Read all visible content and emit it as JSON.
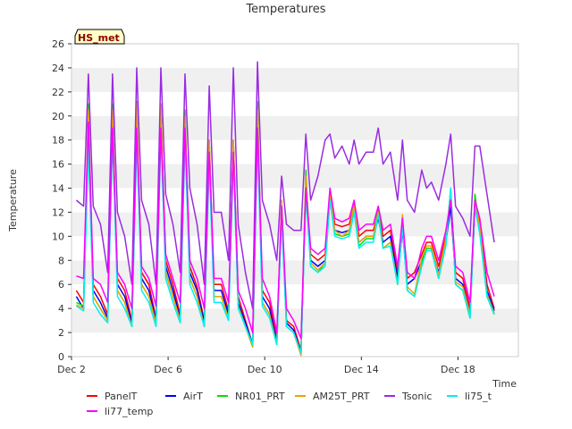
{
  "chart_data": {
    "type": "line",
    "title": "Temperatures",
    "xlabel": "Time",
    "ylabel": "Temperature",
    "badge": "HS_met",
    "ylim": [
      0,
      26
    ],
    "xlim": [
      0,
      18.5
    ],
    "x_unit": "days since Dec 2",
    "yticks": [
      0,
      2,
      4,
      6,
      8,
      10,
      12,
      14,
      16,
      18,
      20,
      22,
      24,
      26
    ],
    "xticks": [
      {
        "value": 0,
        "label": "Dec 2"
      },
      {
        "value": 4,
        "label": "Dec 6"
      },
      {
        "value": 8,
        "label": "Dec 10"
      },
      {
        "value": 12,
        "label": "Dec 14"
      },
      {
        "value": 16,
        "label": "Dec 18"
      }
    ],
    "grid": "horizontal-bands",
    "legend_position": "bottom",
    "x": [
      0.2,
      0.5,
      0.7,
      0.9,
      1.2,
      1.5,
      1.7,
      1.9,
      2.2,
      2.5,
      2.7,
      2.9,
      3.2,
      3.5,
      3.7,
      3.9,
      4.2,
      4.5,
      4.7,
      4.9,
      5.2,
      5.5,
      5.7,
      5.9,
      6.2,
      6.5,
      6.7,
      6.9,
      7.2,
      7.5,
      7.7,
      7.9,
      8.2,
      8.5,
      8.7,
      8.9,
      9.2,
      9.5,
      9.7,
      9.9,
      10.2,
      10.5,
      10.7,
      10.9,
      11.2,
      11.5,
      11.7,
      11.9,
      12.2,
      12.5,
      12.7,
      12.9,
      13.2,
      13.5,
      13.7,
      13.9,
      14.2,
      14.5,
      14.7,
      14.9,
      15.2,
      15.5,
      15.7,
      15.9,
      16.2,
      16.5,
      16.7,
      16.9,
      17.2,
      17.5
    ],
    "series": [
      {
        "name": "PanelT",
        "color": "#ff0000",
        "values": [
          5.5,
          4.5,
          19.0,
          6.0,
          5.0,
          3.5,
          19.5,
          6.5,
          5.5,
          3.0,
          20.0,
          7.0,
          6.0,
          3.2,
          20.5,
          8.0,
          6.0,
          3.5,
          19.5,
          7.5,
          5.8,
          3.0,
          17.5,
          6.0,
          6.0,
          3.8,
          18.0,
          5.0,
          3.0,
          1.0,
          19.5,
          5.5,
          4.5,
          1.5,
          12.5,
          3.0,
          2.5,
          0.5,
          14.5,
          8.5,
          8.0,
          8.5,
          13.5,
          11.0,
          10.8,
          11.0,
          12.5,
          10.0,
          10.5,
          10.5,
          12.0,
          10.0,
          10.5,
          7.0,
          11.0,
          6.5,
          7.0,
          8.5,
          9.5,
          9.5,
          7.5,
          10.0,
          13.0,
          7.0,
          6.5,
          4.0,
          13.0,
          11.0,
          6.0,
          4.0
        ]
      },
      {
        "name": "AirT",
        "color": "#0000ff",
        "values": [
          5.0,
          4.0,
          18.5,
          5.5,
          4.5,
          3.2,
          19.0,
          6.0,
          5.0,
          2.8,
          19.5,
          6.5,
          5.5,
          3.0,
          20.0,
          7.5,
          5.5,
          3.2,
          19.0,
          7.0,
          5.5,
          2.8,
          17.0,
          5.5,
          5.5,
          3.5,
          17.5,
          4.5,
          2.8,
          1.0,
          19.0,
          5.0,
          4.0,
          1.2,
          12.0,
          2.8,
          2.2,
          0.3,
          14.0,
          8.0,
          7.5,
          8.0,
          13.0,
          10.5,
          10.3,
          10.5,
          12.0,
          9.5,
          10.0,
          10.0,
          11.5,
          9.5,
          10.0,
          6.5,
          10.5,
          6.0,
          6.5,
          8.0,
          9.0,
          9.0,
          7.0,
          9.5,
          12.5,
          6.5,
          6.0,
          3.5,
          12.5,
          10.5,
          5.5,
          3.8
        ]
      },
      {
        "name": "NR01_PRT",
        "color": "#00e000",
        "values": [
          4.5,
          4.2,
          21.0,
          5.0,
          4.0,
          3.0,
          21.0,
          5.5,
          4.5,
          2.5,
          21.2,
          6.0,
          5.0,
          2.8,
          21.0,
          7.0,
          5.0,
          3.0,
          20.5,
          6.5,
          5.0,
          2.5,
          18.0,
          5.0,
          5.0,
          3.2,
          18.0,
          4.2,
          2.5,
          0.8,
          21.2,
          4.5,
          3.5,
          1.0,
          13.0,
          2.5,
          2.0,
          0.2,
          15.5,
          7.5,
          7.0,
          7.8,
          13.8,
          10.2,
          10.0,
          10.2,
          12.8,
          9.2,
          9.8,
          9.8,
          12.5,
          9.0,
          9.5,
          6.0,
          11.5,
          5.5,
          5.0,
          7.8,
          9.0,
          9.0,
          6.5,
          9.5,
          14.0,
          6.0,
          5.5,
          3.2,
          13.5,
          10.5,
          5.0,
          3.5
        ]
      },
      {
        "name": "AM25T_PRT",
        "color": "#f0a000",
        "values": [
          4.3,
          4.0,
          20.5,
          5.0,
          4.0,
          3.0,
          20.5,
          5.5,
          4.5,
          2.5,
          21.0,
          6.0,
          5.0,
          2.8,
          21.0,
          7.0,
          5.0,
          3.0,
          20.0,
          6.5,
          5.0,
          2.5,
          18.0,
          5.0,
          5.0,
          3.2,
          18.0,
          4.2,
          2.5,
          0.8,
          20.5,
          4.5,
          3.5,
          1.0,
          13.0,
          2.5,
          2.0,
          0.1,
          15.0,
          7.8,
          7.2,
          7.8,
          13.5,
          10.5,
          10.0,
          10.5,
          12.5,
          9.5,
          10.0,
          10.0,
          12.0,
          9.0,
          9.5,
          6.0,
          11.8,
          5.8,
          5.2,
          8.2,
          9.2,
          9.2,
          6.8,
          9.8,
          13.5,
          6.2,
          5.8,
          3.5,
          13.0,
          10.8,
          5.2,
          3.6
        ]
      },
      {
        "name": "Tsonic",
        "color": "#9a2be2",
        "values": [
          13.0,
          12.5,
          23.5,
          12.5,
          11.0,
          7.0,
          23.5,
          12.0,
          10.0,
          6.0,
          24.0,
          13.0,
          11.0,
          6.0,
          24.0,
          13.5,
          11.0,
          7.0,
          23.5,
          14.0,
          11.0,
          6.0,
          22.5,
          12.0,
          12.0,
          8.0,
          24.0,
          11.0,
          7.0,
          4.0,
          24.5,
          13.0,
          11.0,
          8.0,
          15.0,
          11.0,
          10.5,
          10.5,
          18.5,
          13.0,
          15.0,
          18.0,
          18.5,
          16.5,
          17.5,
          16.0,
          18.0,
          16.0,
          17.0,
          17.0,
          19.0,
          16.0,
          17.0,
          13.0,
          18.0,
          13.0,
          12.0,
          15.5,
          14.0,
          14.5,
          13.0,
          16.0,
          18.5,
          12.5,
          11.5,
          10.0,
          17.5,
          17.5,
          13.5,
          9.5
        ]
      },
      {
        "name": "li75_t",
        "color": "#00f0f0",
        "values": [
          4.2,
          3.8,
          17.5,
          4.5,
          3.5,
          2.8,
          18.5,
          5.0,
          4.0,
          2.5,
          18.0,
          5.5,
          4.5,
          2.5,
          18.5,
          6.5,
          4.5,
          2.8,
          18.0,
          6.0,
          4.5,
          2.5,
          16.0,
          4.5,
          4.5,
          3.0,
          16.5,
          4.0,
          2.5,
          1.0,
          18.0,
          4.2,
          3.2,
          1.0,
          11.5,
          2.5,
          2.0,
          0.3,
          13.5,
          7.5,
          7.0,
          7.5,
          13.0,
          10.0,
          9.8,
          10.0,
          12.0,
          9.0,
          9.5,
          9.5,
          11.8,
          9.0,
          9.2,
          6.0,
          10.8,
          5.5,
          5.0,
          7.5,
          8.8,
          8.8,
          6.5,
          9.2,
          14.0,
          6.0,
          5.5,
          3.2,
          12.5,
          10.2,
          5.0,
          3.5
        ]
      },
      {
        "name": "li77_temp",
        "color": "#ff00ff",
        "values": [
          6.7,
          6.5,
          19.5,
          6.5,
          6.0,
          4.5,
          19.0,
          7.0,
          6.0,
          4.0,
          19.0,
          7.5,
          6.5,
          4.2,
          19.0,
          8.5,
          6.5,
          4.5,
          19.0,
          8.0,
          6.5,
          4.0,
          17.0,
          6.5,
          6.5,
          4.5,
          17.0,
          5.5,
          4.0,
          2.0,
          19.0,
          6.5,
          5.0,
          2.0,
          12.5,
          4.0,
          3.0,
          1.5,
          14.0,
          9.0,
          8.5,
          9.0,
          14.0,
          11.5,
          11.2,
          11.5,
          13.0,
          10.5,
          11.0,
          11.0,
          12.5,
          10.5,
          11.0,
          7.5,
          11.5,
          7.0,
          6.5,
          9.0,
          10.0,
          10.0,
          8.0,
          10.5,
          13.0,
          7.5,
          7.0,
          4.5,
          13.0,
          11.5,
          7.0,
          5.0
        ]
      }
    ]
  }
}
